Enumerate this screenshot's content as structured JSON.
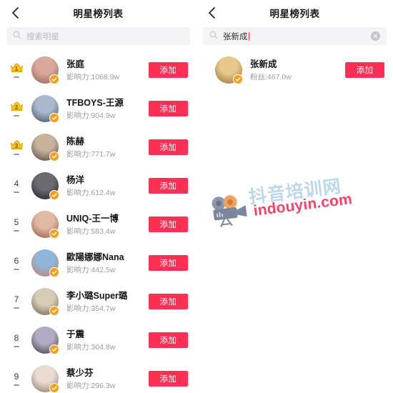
{
  "colors": {
    "accent_red": "#fa3055",
    "verified_orange": "#f6a01a",
    "crown_gold": "#f6c game",
    "search_bg": "#f4f4f6",
    "text_primary": "#141414",
    "text_muted": "#9b9b9f",
    "watermark_blue": "#bcd7ea",
    "watermark_red": "#f4436b"
  },
  "left_panel": {
    "header": {
      "back_icon": "chevron-left-icon",
      "title": "明星榜列表"
    },
    "search": {
      "icon": "search-icon",
      "placeholder": "搜索明星",
      "value": ""
    },
    "list": [
      {
        "rank": "1",
        "badge": "crown",
        "change": "-",
        "name": "张庭",
        "meta": "影响力:1068.9w",
        "verified": true,
        "action": "添加",
        "avatar_c1": "#d9a89a",
        "avatar_c2": "#8b5f4e"
      },
      {
        "rank": "2",
        "badge": "crown",
        "change": "-",
        "name": "TFBOYS-王源",
        "meta": "影响力:904.9w",
        "verified": true,
        "action": "添加",
        "avatar_c1": "#aab9cd",
        "avatar_c2": "#3c4a60"
      },
      {
        "rank": "3",
        "badge": "crown",
        "change": "-",
        "name": "陈赫",
        "meta": "影响力:771.7w",
        "verified": true,
        "action": "添加",
        "avatar_c1": "#c9b29b",
        "avatar_c2": "#45403c"
      },
      {
        "rank": "4",
        "badge": "number",
        "change": "-",
        "name": "杨洋",
        "meta": "影响力:612.4w",
        "verified": true,
        "action": "添加",
        "avatar_c1": "#6a6a70",
        "avatar_c2": "#1d1d22"
      },
      {
        "rank": "5",
        "badge": "number",
        "change": "-",
        "name": "UNIQ-王一博",
        "meta": "影响力:583.4w",
        "verified": true,
        "action": "添加",
        "avatar_c1": "#e0b9a6",
        "avatar_c2": "#96523a"
      },
      {
        "rank": "6",
        "badge": "number",
        "change": "-",
        "name": "歐陽娜娜Nana",
        "meta": "影响力:442.5w",
        "verified": true,
        "action": "添加",
        "avatar_c1": "#8fb6d8",
        "avatar_c2": "#c9796a"
      },
      {
        "rank": "7",
        "badge": "number",
        "change": "-",
        "name": "李小璐Super璐",
        "meta": "影响力:354.7w",
        "verified": true,
        "action": "添加",
        "avatar_c1": "#d7cdb6",
        "avatar_c2": "#6e5a46"
      },
      {
        "rank": "8",
        "badge": "number",
        "change": "-",
        "name": "于震",
        "meta": "影响力:304.8w",
        "verified": true,
        "action": "添加",
        "avatar_c1": "#b2abc6",
        "avatar_c2": "#3a3540"
      },
      {
        "rank": "9",
        "badge": "number",
        "change": "-",
        "name": "蔡少芬",
        "meta": "影响力:296.3w",
        "verified": true,
        "action": "添加",
        "avatar_c1": "#e8dcd3",
        "avatar_c2": "#8d6d5c"
      }
    ]
  },
  "right_panel": {
    "header": {
      "back_icon": "chevron-left-icon",
      "title": "明星榜列表"
    },
    "search": {
      "icon": "search-icon",
      "placeholder": "搜索明星",
      "value": "张新成",
      "clear_icon": "clear-circle-icon"
    },
    "results": [
      {
        "name": "张新成",
        "meta": "粉丝:467.0w",
        "verified": true,
        "action": "添加",
        "avatar_c1": "#e6c98a",
        "avatar_c2": "#9a6b2f"
      }
    ]
  },
  "watermark": {
    "icon": "video-camera-icon",
    "chinese": "抖音培训网",
    "english": "indouyin.com"
  }
}
